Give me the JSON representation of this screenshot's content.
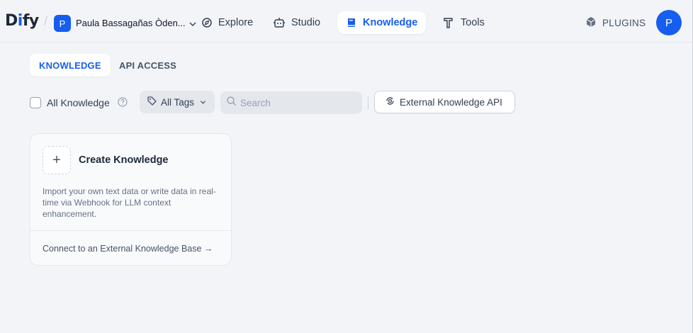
{
  "header": {
    "logo": {
      "part1": "D",
      "part2": "i",
      "part3": "fy"
    },
    "workspace": {
      "initial": "P",
      "name": "Paula Bassagañas Òden..."
    },
    "nav": [
      {
        "label": "Explore",
        "icon": "compass-icon"
      },
      {
        "label": "Studio",
        "icon": "robot-icon"
      },
      {
        "label": "Knowledge",
        "icon": "book-icon",
        "active": true
      },
      {
        "label": "Tools",
        "icon": "hammer-icon"
      }
    ],
    "plugins_label": "PLUGINS",
    "user_initial": "P"
  },
  "tabs": [
    {
      "label": "KNOWLEDGE",
      "active": true
    },
    {
      "label": "API ACCESS",
      "active": false
    }
  ],
  "toolbar": {
    "all_knowledge_label": "All Knowledge",
    "all_knowledge_checked": false,
    "tags_label": "All Tags",
    "search_placeholder": "Search",
    "search_value": "",
    "external_api_label": "External Knowledge API"
  },
  "create_card": {
    "title": "Create Knowledge",
    "description": "Import your own text data or write data in real-time via Webhook for LLM context enhancement.",
    "external_link": "Connect to an External Knowledge Base →"
  },
  "colors": {
    "accent": "#155eef",
    "background": "#f2f4f7",
    "text": "#344054"
  }
}
